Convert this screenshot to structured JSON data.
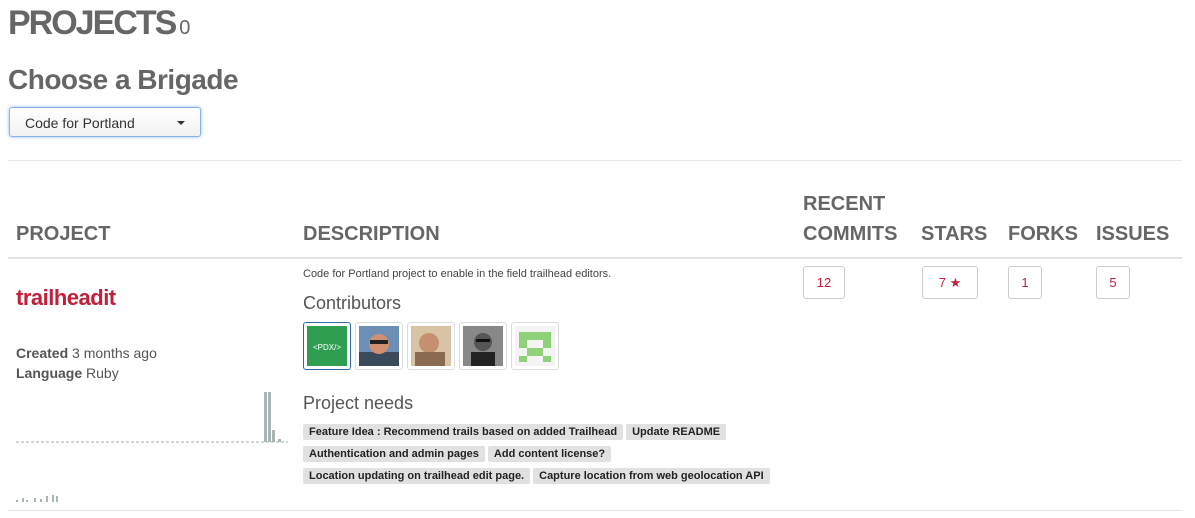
{
  "header": {
    "title": "PROJECTS",
    "count": "0",
    "choose_label": "Choose a Brigade"
  },
  "brigade_select": {
    "value": "Code for Portland"
  },
  "table": {
    "headers": {
      "project": "PROJECT",
      "description": "DESCRIPTION",
      "recent_commits_1": "RECENT",
      "recent_commits_2": "COMMITS",
      "stars": "STARS",
      "forks": "FORKS",
      "issues": "ISSUES"
    },
    "rows": [
      {
        "name": "trailheadit",
        "created_label": "Created",
        "created_value": "3 months ago",
        "language_label": "Language",
        "language_value": "Ruby",
        "description": "Code for Portland project to enable in the field trailhead editors.",
        "contributors_label": "Contributors",
        "contributors": [
          {
            "alt": "<PDX/>",
            "icon": "pdx-logo"
          },
          {
            "alt": "contributor",
            "icon": "photo-avatar"
          },
          {
            "alt": "contributor",
            "icon": "photo-avatar"
          },
          {
            "alt": "contributor",
            "icon": "photo-avatar"
          },
          {
            "alt": "contributor",
            "icon": "identicon"
          }
        ],
        "needs_label": "Project needs",
        "needs": [
          "Feature Idea : Recommend trails based on added Trailhead",
          "Update README",
          "Authentication and admin pages",
          "Add content license?",
          "Location updating on trailhead edit page.",
          "Capture location from web geolocation API"
        ],
        "recent_commits": "12",
        "stars": "7",
        "star_icon": "star-icon",
        "forks": "1",
        "issues": "5"
      }
    ]
  },
  "colors": {
    "accent": "#c0203a",
    "tag_bg": "#e1e1e1",
    "pdx_green": "#2e9e50"
  }
}
